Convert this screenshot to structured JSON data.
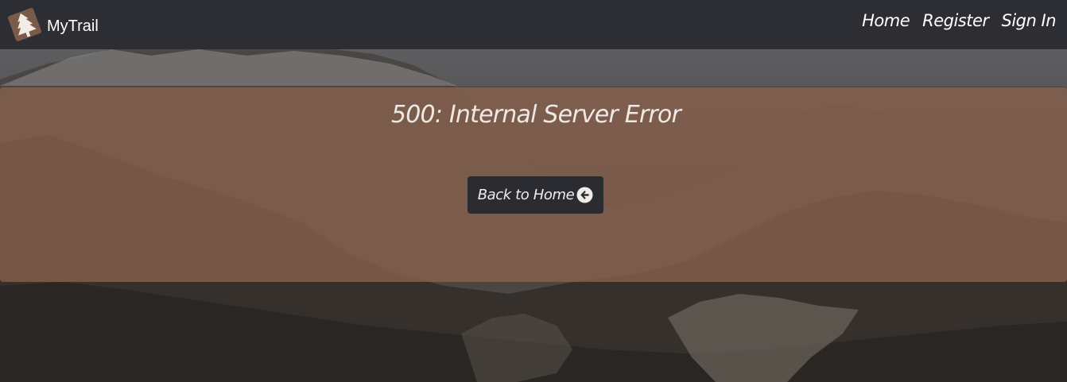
{
  "navbar": {
    "brand": "MyTrail",
    "links": [
      {
        "label": "Home"
      },
      {
        "label": "Register"
      },
      {
        "label": "Sign In"
      }
    ]
  },
  "error": {
    "title": "500: Internal Server Error",
    "back_button_label": "Back to Home",
    "back_button_icon": "arrow-circle-left-icon"
  },
  "colors": {
    "navbar_bg": "#2d2e33",
    "panel_bg": "#87604c",
    "button_bg": "#2b2c31",
    "text_light": "#ffffff"
  },
  "logo_icon": "tree-icon"
}
